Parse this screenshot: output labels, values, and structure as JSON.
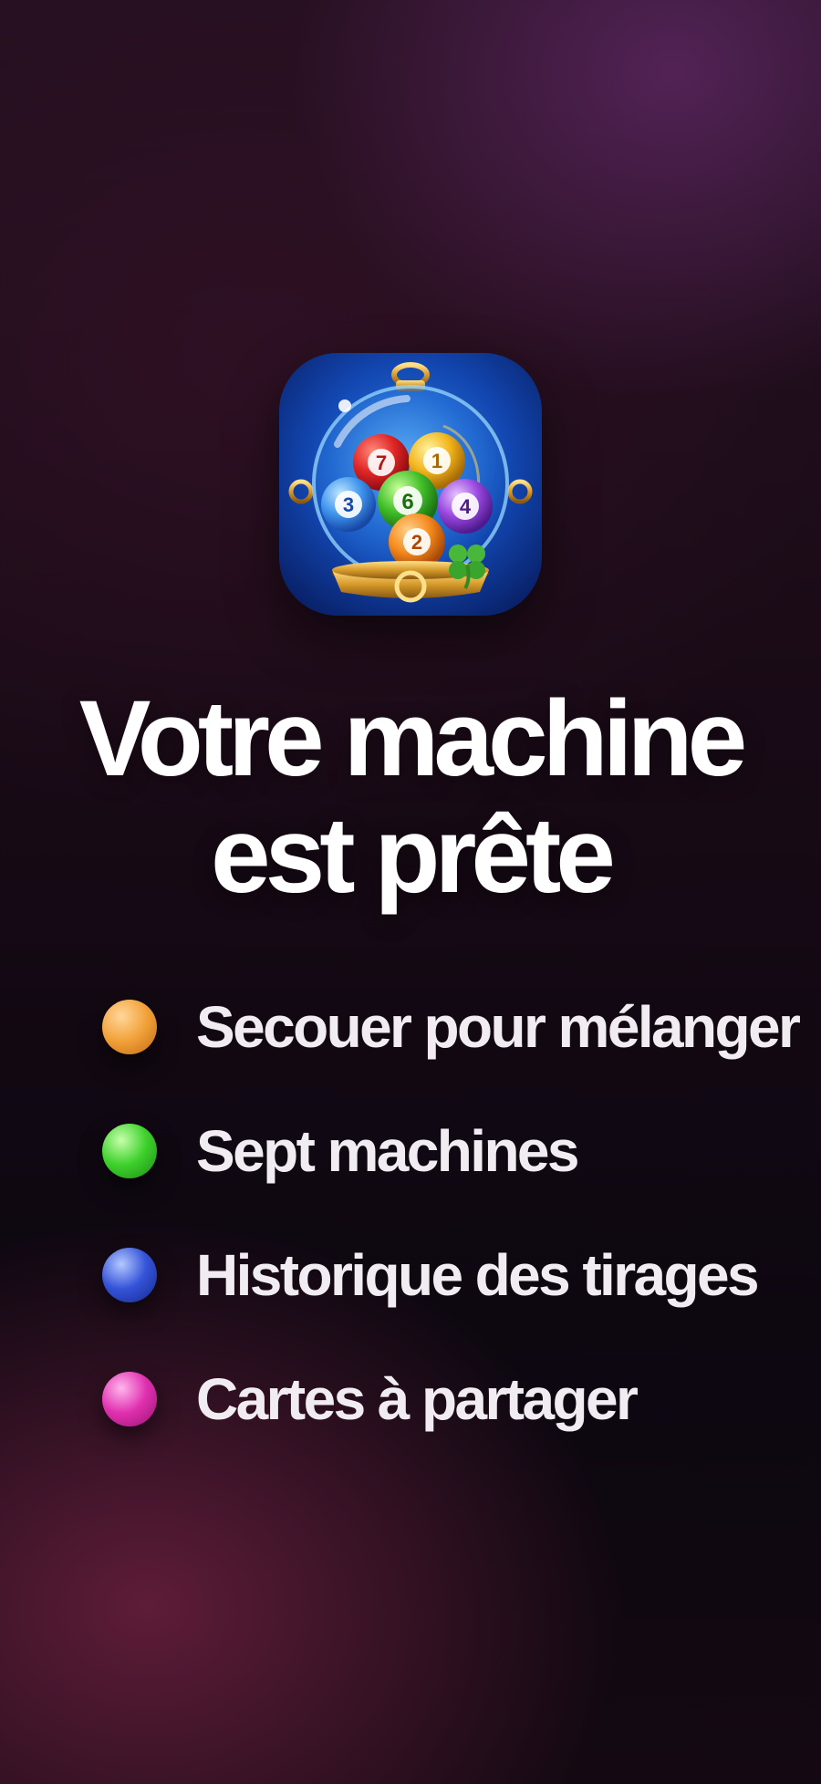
{
  "screen": {
    "app_icon": {
      "icon": "lottery-ball-machine-icon",
      "balls": [
        "7",
        "1",
        "3",
        "6",
        "4",
        "2"
      ]
    },
    "headline": {
      "line1": "Votre machine",
      "line2": "est prête"
    },
    "features": [
      {
        "label": "Secouer pour mélanger",
        "dot_color": "#f2a23a"
      },
      {
        "label": "Sept machines",
        "dot_color": "#3ed12c"
      },
      {
        "label": "Historique des tirages",
        "dot_color": "#3453d8"
      },
      {
        "label": "Cartes à partager",
        "dot_color": "#e030b0"
      }
    ]
  }
}
